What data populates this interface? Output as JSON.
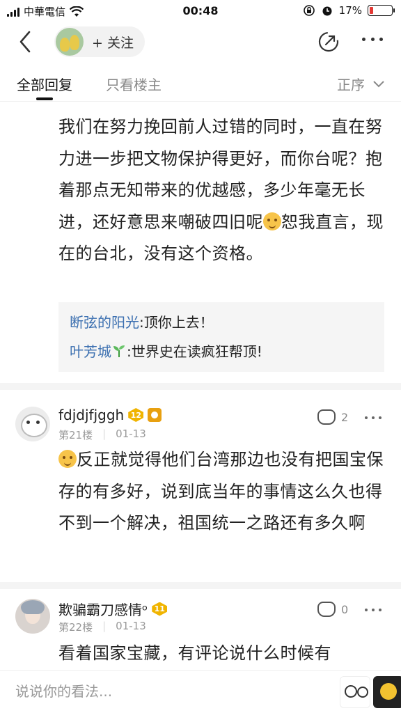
{
  "status_bar": {
    "carrier": "中華電信",
    "time": "00:48",
    "battery": "17%",
    "battery_level": 0.17
  },
  "header": {
    "follow_label": "+ 关注",
    "icons": [
      "back-icon",
      "share-icon",
      "more-icon"
    ]
  },
  "tabs": {
    "all": "全部回复",
    "author_only": "只看楼主",
    "sort": "正序"
  },
  "post": {
    "text_before_emoji": "我们在努力挽回前人过错的同时，一直在努力进一步把文物保护得更好，而你台呢？抱着那点无知带来的优越感，多少年毫无长进，还好意思来嘲破四旧呢",
    "text_after_emoji": "恕我直言，现在的台北，没有这个资格。",
    "replies": [
      {
        "name": "断弦的阳光",
        "text": ":顶你上去！"
      },
      {
        "name": "叶芳城",
        "text": ":世界史在读疯狂帮顶!"
      }
    ]
  },
  "floors": [
    {
      "username": "fdjdjfjggh",
      "level": "12",
      "floor": "第21楼",
      "date": "01-13",
      "likes": "2",
      "text": "反正就觉得他们台湾那边也没有把国宝保存的有多好，说到底当年的事情这么久也得不到一个解决，祖国统一之路还有多久啊"
    },
    {
      "username": "欺骗霸刀感情ᵒ",
      "level": "11",
      "floor": "第22楼",
      "date": "01-13",
      "likes": "0",
      "text": "看着国家宝藏，有评论说什么时候有"
    }
  ],
  "bottom": {
    "placeholder": "说说你的看法..."
  }
}
